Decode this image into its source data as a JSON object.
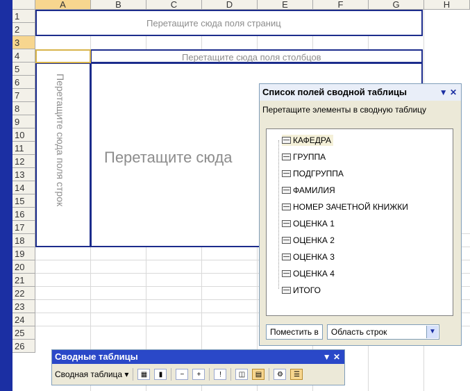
{
  "sheet": {
    "columns": [
      "A",
      "B",
      "C",
      "D",
      "E",
      "F",
      "G",
      "H"
    ],
    "rows": [
      "1",
      "2",
      "3",
      "4",
      "5",
      "6",
      "7",
      "8",
      "9",
      "10",
      "11",
      "12",
      "13",
      "14",
      "15",
      "16",
      "17",
      "18",
      "19",
      "20",
      "21",
      "22",
      "23",
      "24",
      "25",
      "26"
    ],
    "hints": {
      "pages": "Перетащите сюда поля страниц",
      "columns": "Перетащите сюда поля столбцов",
      "data": "Перетащите сюда",
      "rows": "Перетащите сюда поля строк"
    }
  },
  "field_list_panel": {
    "title": "Список полей сводной таблицы",
    "subtitle": "Перетащите элементы в сводную таблицу",
    "fields": [
      "КАФЕДРА",
      "ГРУППА",
      "ПОДГРУППА",
      "ФАМИЛИЯ",
      "НОМЕР ЗАЧЕТНОЙ КНИЖКИ",
      "ОЦЕНКА 1",
      "ОЦЕНКА 2",
      "ОЦЕНКА 3",
      "ОЦЕНКА 4",
      "ИТОГО"
    ],
    "place_button": "Поместить в",
    "area_select": "Область строк"
  },
  "pivot_toolbar": {
    "title": "Сводные таблицы",
    "menu_label": "Сводная таблица"
  }
}
